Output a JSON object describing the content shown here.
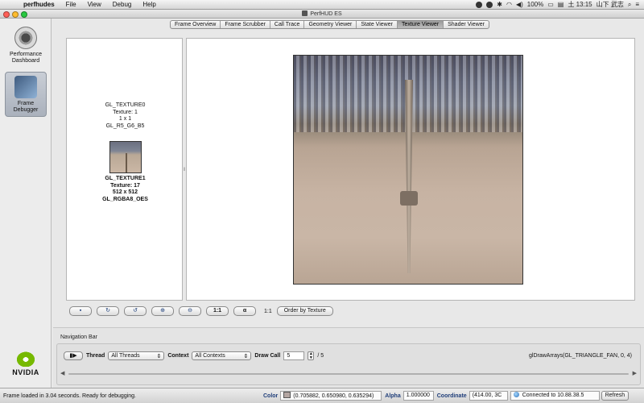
{
  "menubar": {
    "app": "perfhudes",
    "items": [
      "File",
      "View",
      "Debug",
      "Help"
    ],
    "battery": "100%",
    "clock": "土 13:15",
    "user": "山下 武志"
  },
  "window": {
    "title": "PerfHUD ES"
  },
  "sidebar": {
    "performance_dashboard": "Performance Dashboard",
    "frame_debugger": "Frame Debugger",
    "logo": "NVIDIA"
  },
  "tabs": [
    {
      "label": "Frame Overview"
    },
    {
      "label": "Frame Scrubber"
    },
    {
      "label": "Call Trace"
    },
    {
      "label": "Geometry Viewer"
    },
    {
      "label": "State Viewer"
    },
    {
      "label": "Texture Viewer",
      "active": true
    },
    {
      "label": "Shader Viewer"
    }
  ],
  "textures": [
    {
      "unit": "GL_TEXTURE0",
      "texture": "Texture: 1",
      "size": "1 x 1",
      "format": "GL_R5_G6_B5"
    },
    {
      "unit": "GL_TEXTURE1",
      "texture": "Texture: 17",
      "size": "512 x 512",
      "format": "GL_RGBA8_OES"
    }
  ],
  "toolbar": {
    "save_icon": "save-icon",
    "rotate_cw_icon": "rotate-cw-icon",
    "rotate_ccw_icon": "rotate-ccw-icon",
    "zoom_in_icon": "zoom-in-icon",
    "zoom_out_icon": "zoom-out-icon",
    "actual_size_label": "1:1",
    "alpha_label": "α",
    "zoom_level": "1:1",
    "order_label": "Order by Texture"
  },
  "nav": {
    "title": "Navigation Bar",
    "thread_label": "Thread",
    "thread_value": "All Threads",
    "context_label": "Context",
    "context_value": "All Contexts",
    "drawcall_label": "Draw Call",
    "drawcall_value": "5",
    "drawcall_total": "/ 5",
    "current_call": "glDrawArrays(GL_TRIANGLE_FAN, 0, 4)"
  },
  "status": {
    "message": "Frame loaded in 3.04 seconds.  Ready for debugging.",
    "color_label": "Color",
    "color_value": "(0.705882, 0.650980, 0.635294)",
    "swatch_color": "#b4a6a2",
    "alpha_label": "Alpha",
    "alpha_value": "1.000000",
    "coord_label": "Coordinate",
    "coord_value": "(414.00, 3C",
    "connection": "Connected to 10.88.38.5",
    "refresh_label": "Refresh"
  },
  "colors": {
    "close": "#ff5f57",
    "minimize": "#febc2e",
    "zoom": "#28c840",
    "nvidia_green": "#76b900"
  }
}
